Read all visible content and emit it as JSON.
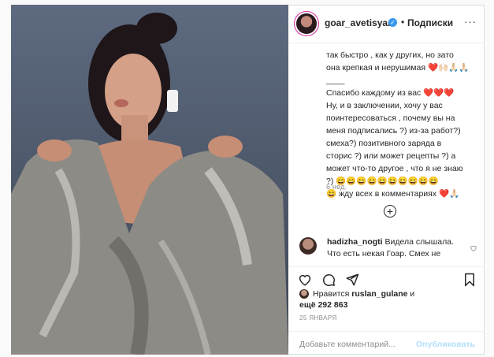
{
  "post": {
    "username": "goar_avetisyan",
    "follow_label": "Подписки",
    "separator": "•",
    "more_label": "···",
    "verified_mark": "✓",
    "caption_lines": [
      "так быстро , как у других, но зато",
      "она крепкая и нерушимая",
      "____",
      "Спасибо каждому из вас",
      "Ну, и в заключении, хочу у вас",
      "поинтересоваться , почему вы на",
      "меня подписались ?) из-за работ?)",
      "смеха?) позитивного заряда в",
      "сторис ?) или может рецепты ?) а",
      "может что-то другое , что я не знаю",
      "?)",
      "ждy всех в комментариях"
    ],
    "caption_emoji": {
      "line2": "❤️🙌🏻🙏🏻🙏🏻",
      "line4": "❤️❤️❤️",
      "line11": "😄😄😄😄😄😄😄😄😄😄",
      "line12_prefix": "😄",
      "line12_suffix": "❤️🙏🏻"
    },
    "age": "6 нед.",
    "load_more": "+"
  },
  "comment": {
    "username": "hadizha_nogti",
    "text": "Видела слышала. Что есть некая Гоар. Смех не"
  },
  "likes": {
    "prefix": "Нравится",
    "user": "ruslan_gulane",
    "conj": "и",
    "more": "ещё 292 863"
  },
  "date": "25 ЯНВАРЯ",
  "add_comment": {
    "placeholder": "Добавьте комментарий...",
    "publish_label": "Опубликовать"
  },
  "colors": {
    "accent": "#3897f0",
    "publish_disabled": "#b2dffc",
    "heart": "#e0143d"
  }
}
